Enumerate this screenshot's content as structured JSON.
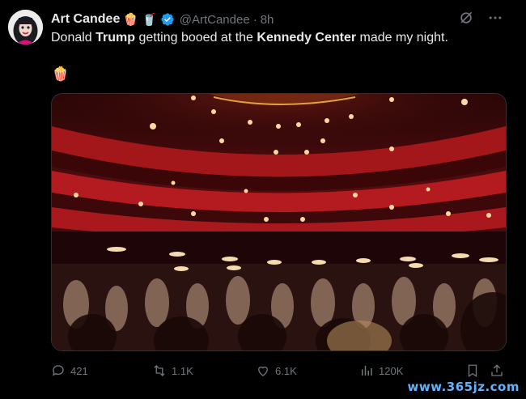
{
  "author": {
    "name": "Art Candee",
    "emojis": [
      "🍿",
      "🥤"
    ],
    "handle": "@ArtCandee",
    "separator": "·",
    "time": "8h",
    "verified": true
  },
  "tweet": {
    "text_parts": [
      {
        "text": "Donald ",
        "bold": false
      },
      {
        "text": "Trump",
        "bold": true
      },
      {
        "text": " getting booed at the ",
        "bold": false
      },
      {
        "text": "Kennedy Center",
        "bold": true
      },
      {
        "text": " made my night.",
        "bold": false
      }
    ],
    "emoji_line": "🍿"
  },
  "media": {
    "type": "video-still",
    "description_icon": "concert-hall-image"
  },
  "actions": {
    "replies": "421",
    "reposts": "1.1K",
    "likes": "6.1K",
    "views": "120K"
  },
  "icons": {
    "top": [
      "grok-icon",
      "more-icon"
    ],
    "actions": [
      "reply-icon",
      "repost-icon",
      "like-icon",
      "views-icon",
      "bookmark-icon",
      "share-icon"
    ]
  },
  "colors": {
    "background": "#000000",
    "text": "#e7e9ea",
    "muted": "#71767b",
    "verified": "#1d9bf0"
  },
  "watermark": "www.365jz.com"
}
